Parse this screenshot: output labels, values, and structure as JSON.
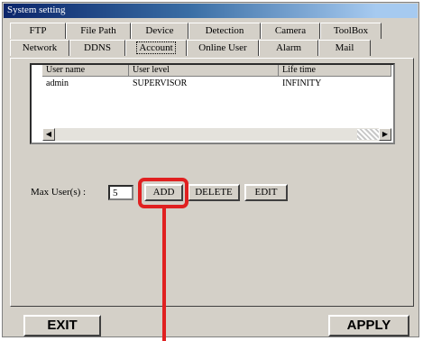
{
  "window": {
    "title": "System setting"
  },
  "tabs": {
    "row1": [
      {
        "label": "FTP",
        "width": 62
      },
      {
        "label": "File Path",
        "width": 72
      },
      {
        "label": "Device",
        "width": 64
      },
      {
        "label": "Detection",
        "width": 80
      },
      {
        "label": "Camera",
        "width": 66
      },
      {
        "label": "ToolBox",
        "width": 68
      }
    ],
    "row2": [
      {
        "label": "Network",
        "width": 66
      },
      {
        "label": "DDNS",
        "width": 62
      },
      {
        "label": "Account",
        "width": 68,
        "active": true
      },
      {
        "label": "Online User",
        "width": 80
      },
      {
        "label": "Alarm",
        "width": 66
      },
      {
        "label": "Mail",
        "width": 58
      }
    ]
  },
  "user_list": {
    "columns": [
      "User name",
      "User level",
      "Life time"
    ],
    "rows": [
      [
        "admin",
        "SUPERVISOR",
        "INFINITY"
      ]
    ]
  },
  "max_users": {
    "label": "Max User(s) :",
    "value": "5"
  },
  "buttons": {
    "add": "ADD",
    "delete": "DELETE",
    "edit": "EDIT"
  },
  "footer": {
    "exit": "EXIT",
    "apply": "APPLY"
  },
  "colors": {
    "highlight": "#e02020",
    "face": "#d4d0c8"
  }
}
